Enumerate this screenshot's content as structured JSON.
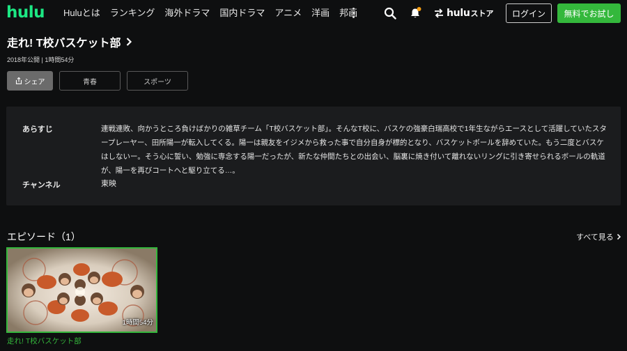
{
  "header": {
    "logo": "hulu",
    "nav": [
      "Huluとは",
      "ランキング",
      "海外ドラマ",
      "国内ドラマ",
      "アニメ",
      "洋画",
      "邦画"
    ],
    "store_logo": "hulu",
    "store_suffix": "ストア",
    "login_label": "ログイン",
    "trial_label": "無料でお試し",
    "icons": [
      "more-vertical-icon",
      "search-icon",
      "bell-icon",
      "swap-icon"
    ],
    "accent_color": "#1ce783",
    "button_color": "#34b83c",
    "notification_dot_color": "#f39c12"
  },
  "title": {
    "name": "走れ! T校バスケット部",
    "meta": "2018年公開 | 1時間54分"
  },
  "actions": {
    "share_label": "シェア",
    "tags": [
      "青春",
      "スポーツ"
    ]
  },
  "info": {
    "synopsis_label": "あらすじ",
    "synopsis": "連戦連敗、向かうところ負けばかりの雑草チーム「T校バスケット部」。そんなT校に、バスケの強豪白瑞高校で1年生ながらエースとして活躍していたスタープレーヤー、田所陽一が転入してくる。陽一は親友をイジメから救った事で自分自身が標的となり、バスケットボールを辞めていた。もう二度とバスケはしないー。そう心に誓い、勉強に専念する陽一だったが、新たな仲間たちとの出会い、脳裏に焼き付いて離れないリングに引き寄せられるボールの軌道が、陽一を再びコートへと駆り立てる…。",
    "channel_label": "チャンネル",
    "channel": "東映"
  },
  "episodes": {
    "heading": "エピソード（1）",
    "see_all": "すべて見る",
    "items": [
      {
        "title": "走れ! T校バスケット部",
        "duration": "1時間54分"
      }
    ]
  }
}
